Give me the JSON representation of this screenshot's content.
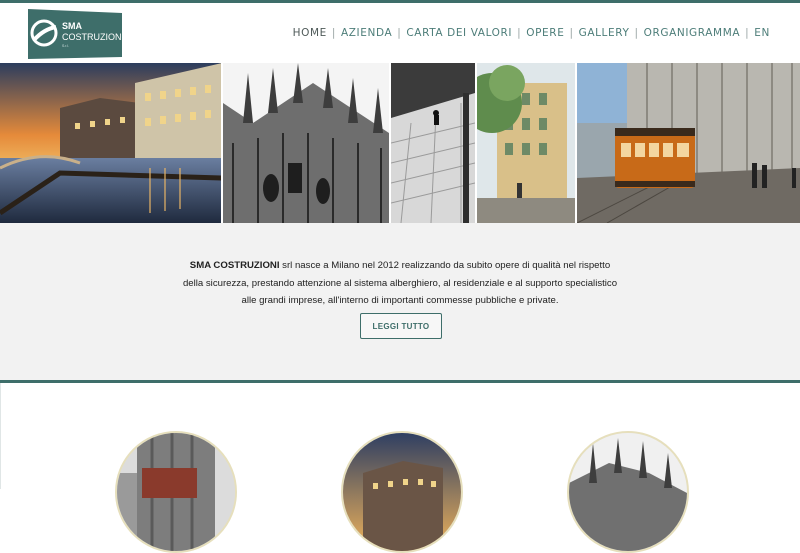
{
  "logo": {
    "name": "SMA",
    "subname": "COSTRUZIONI",
    "suffix": "S.r.l."
  },
  "nav": {
    "items": [
      "HOME",
      "AZIENDA",
      "CARTA DEI VALORI",
      "OPERE",
      "GALLERY",
      "ORGANIGRAMMA",
      "EN"
    ],
    "separator": "|"
  },
  "intro": {
    "company": "SMA COSTRUZIONI",
    "text": " srl nasce a Milano nel 2012 realizzando da subito opere di qualità nel rispetto della sicurezza, prestando attenzione al sistema alberghiero, al residenziale e al supporto specialistico alle grandi imprese, all'interno di importanti commesse pubbliche e private.",
    "button": "LEGGI TUTTO"
  },
  "colors": {
    "accent": "#3e6e6a",
    "nav": "#4d7d79",
    "background": "#f2f2f2"
  }
}
